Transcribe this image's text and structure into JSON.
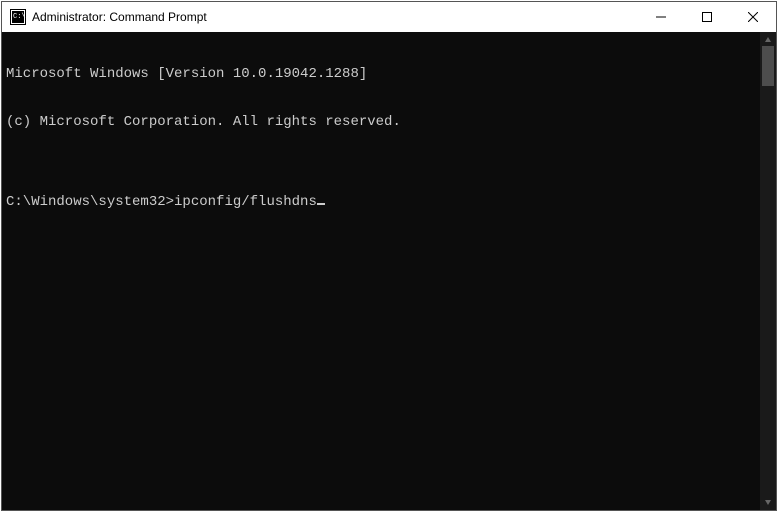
{
  "window": {
    "title": "Administrator: Command Prompt"
  },
  "terminal": {
    "line1": "Microsoft Windows [Version 10.0.19042.1288]",
    "line2": "(c) Microsoft Corporation. All rights reserved.",
    "blank": "",
    "prompt": "C:\\Windows\\system32>",
    "command": "ipconfig/flushdns"
  }
}
